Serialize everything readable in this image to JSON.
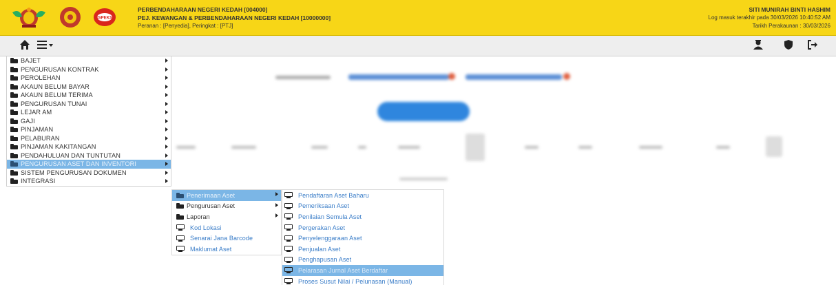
{
  "header": {
    "org_line": "PERBENDAHARAAN NEGERI KEDAH [004000]",
    "dept_line": "PEJ. KEWANGAN & PERBENDAHARAAN NEGERI KEDAH [10000000]",
    "role_line": "Peranan : [Penyedia], Peringkat : [PTJ]",
    "user_name": "SITI MUNIRAH BINTI HASHIM",
    "last_login": "Log masuk terakhir pada 30/03/2026 10:40:52 AM",
    "accounting_date": "Tarikh Perakaunan : 30/03/2026",
    "logo_text": "iSPEKS",
    "colors": {
      "header_bg": "#f7d617",
      "menu_highlight": "#7bb6e6",
      "link": "#3a7dc8"
    }
  },
  "navbar": {
    "icons": [
      "home-icon",
      "menu-icon",
      "user-icon",
      "shield-icon",
      "logout-icon"
    ]
  },
  "menu": {
    "items": [
      {
        "label": "BAJET"
      },
      {
        "label": "PENGURUSAN KONTRAK"
      },
      {
        "label": "PEROLEHAN"
      },
      {
        "label": "AKAUN BELUM BAYAR"
      },
      {
        "label": "AKAUN BELUM TERIMA"
      },
      {
        "label": "PENGURUSAN TUNAI"
      },
      {
        "label": "LEJAR AM"
      },
      {
        "label": "GAJI"
      },
      {
        "label": "PINJAMAN"
      },
      {
        "label": "PELABURAN"
      },
      {
        "label": "PINJAMAN KAKITANGAN"
      },
      {
        "label": "PENDAHULUAN DAN TUNTUTAN"
      },
      {
        "label": "PENGURUSAN ASET DAN INVENTORI"
      },
      {
        "label": "SISTEM PENGURUSAN DOKUMEN"
      },
      {
        "label": "INTEGRASI"
      }
    ]
  },
  "submenu": {
    "items": [
      {
        "label": "Penerimaan Aset"
      },
      {
        "label": "Pengurusan Aset"
      },
      {
        "label": "Laporan"
      },
      {
        "label": "Kod Lokasi"
      },
      {
        "label": "Senarai Jana Barcode"
      },
      {
        "label": "Maklumat Aset"
      }
    ]
  },
  "subsubmenu": {
    "items": [
      {
        "label": "Pendaftaran Aset Baharu"
      },
      {
        "label": "Pemeriksaan Aset"
      },
      {
        "label": "Penilaian Semula Aset"
      },
      {
        "label": "Pergerakan Aset"
      },
      {
        "label": "Penyelenggaraan Aset"
      },
      {
        "label": "Penjualan Aset"
      },
      {
        "label": "Penghapusan Aset"
      },
      {
        "label": "Pelarasan Jurnal Aset Berdaftar"
      },
      {
        "label": "Proses Susut Nilai / Pelunasan (Manual)"
      }
    ]
  }
}
